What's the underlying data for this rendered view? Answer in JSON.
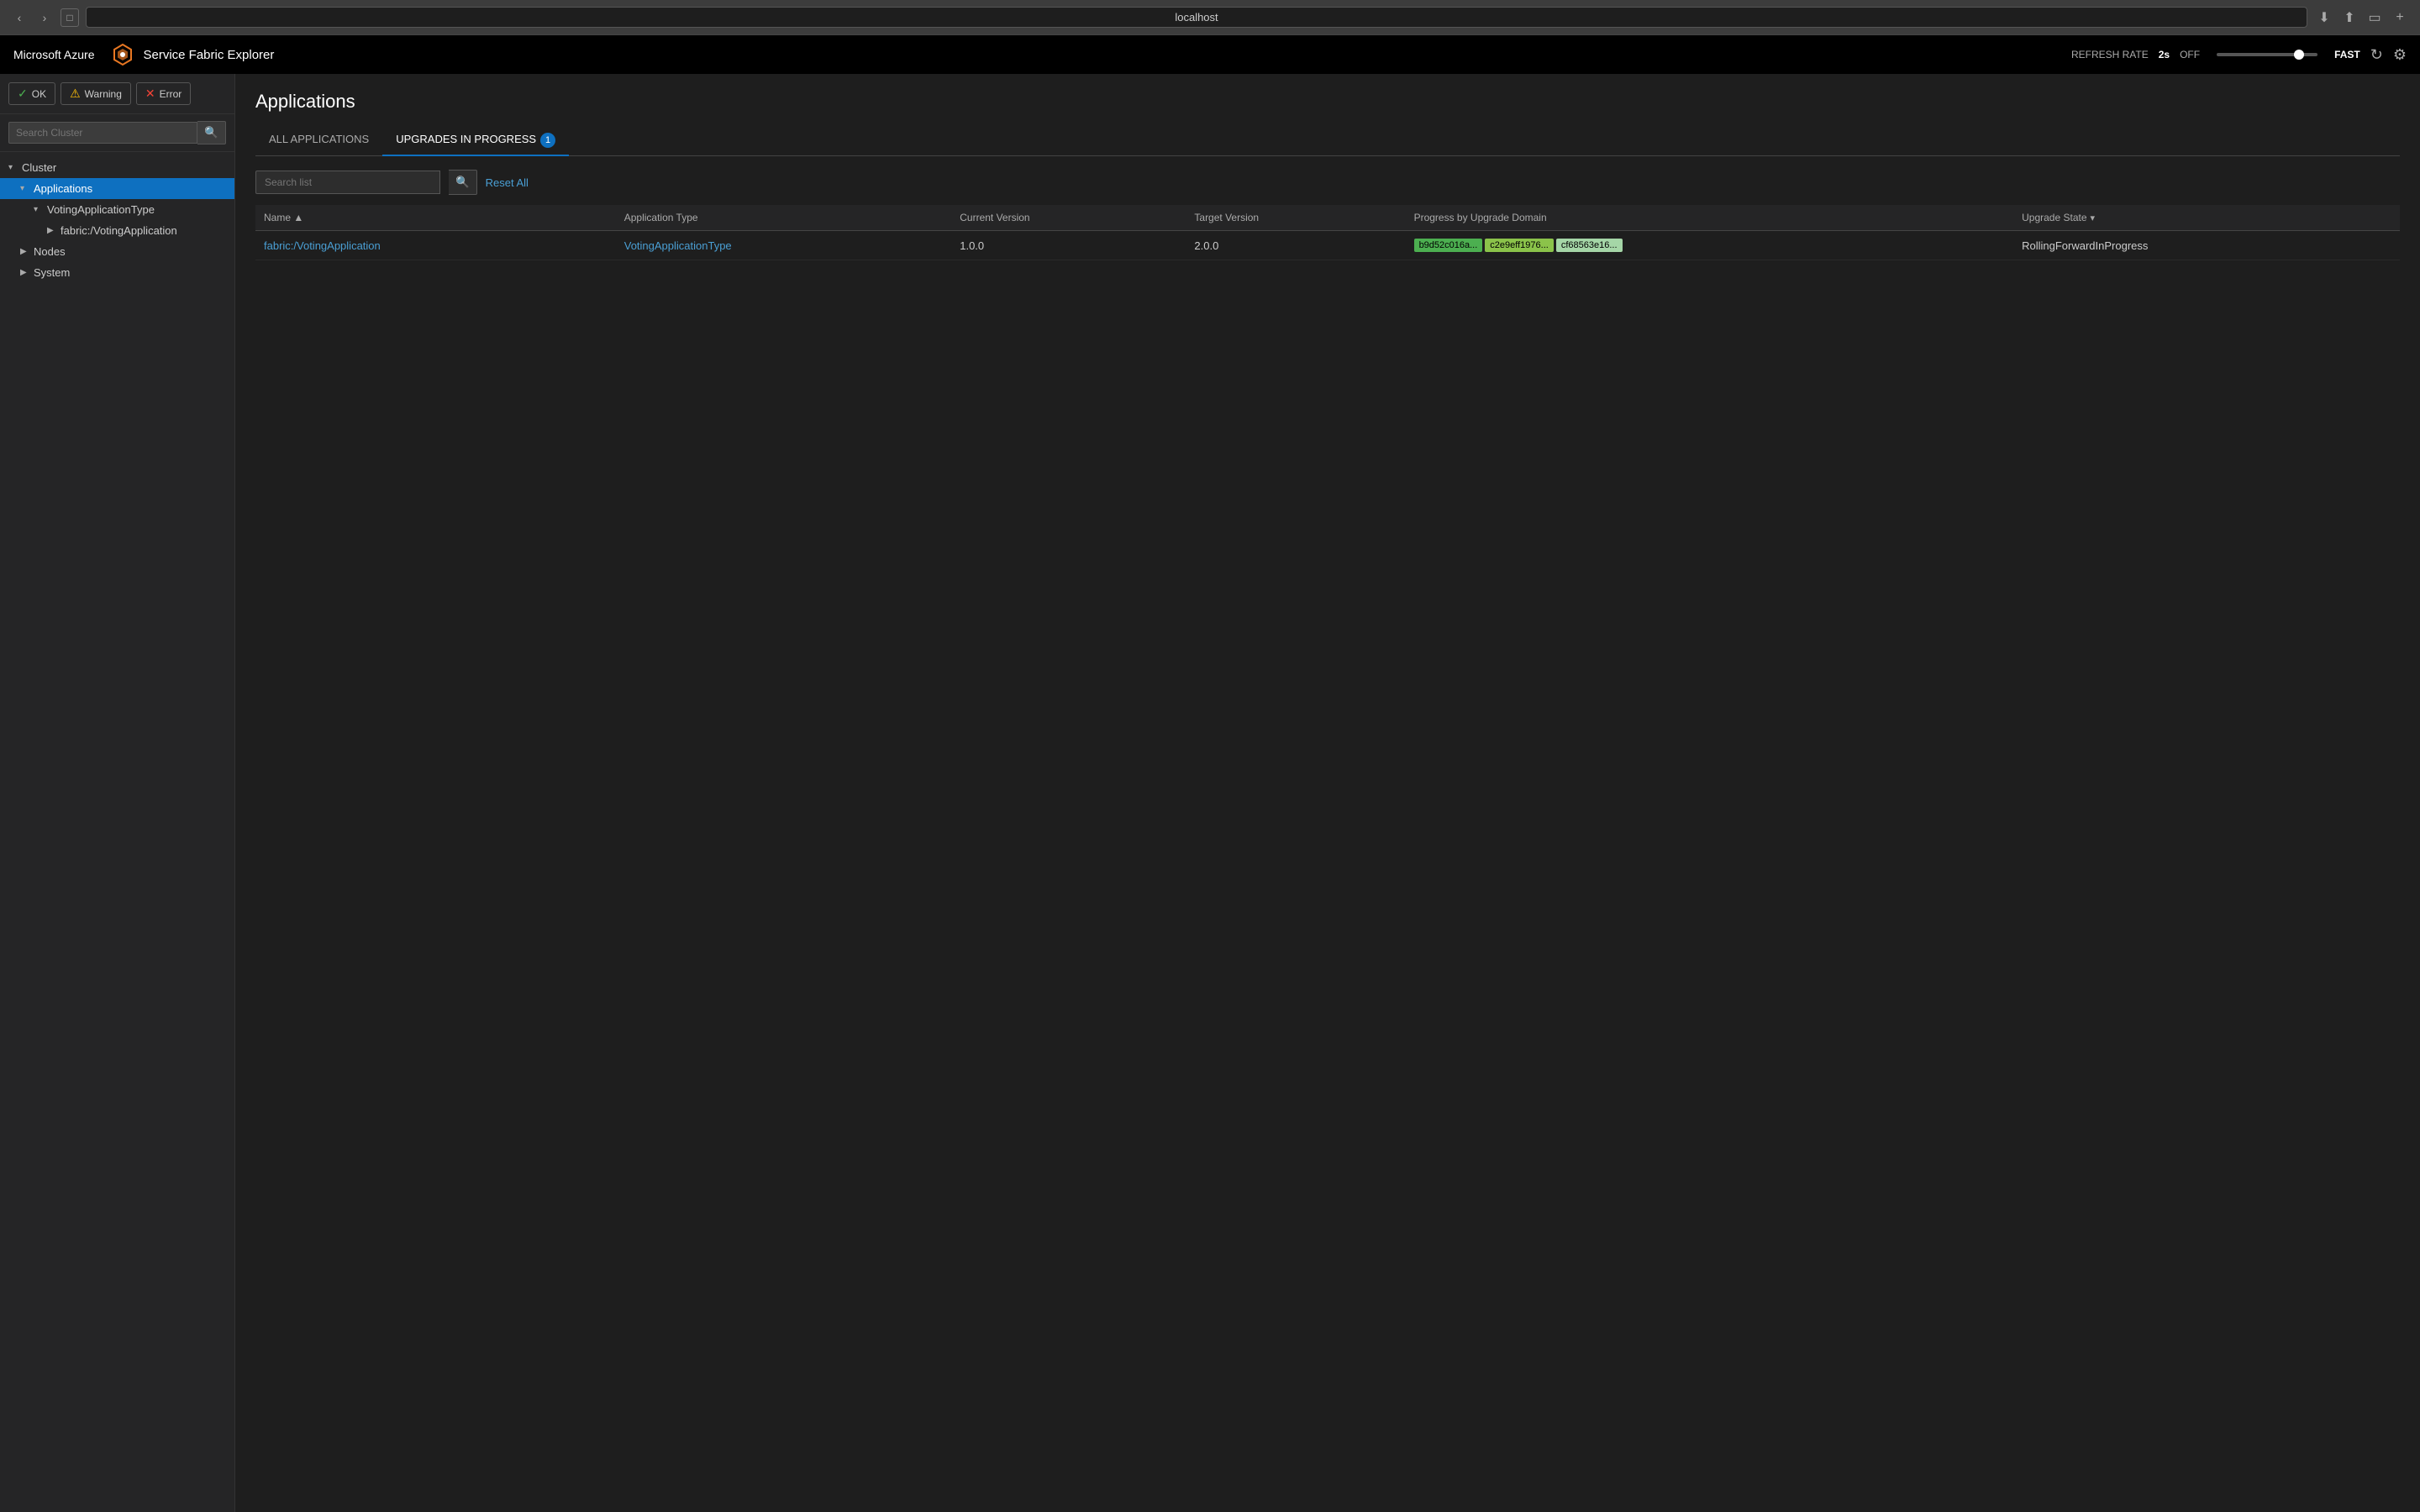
{
  "browser": {
    "url": "localhost",
    "nav_back": "‹",
    "nav_forward": "›",
    "nav_window": "□"
  },
  "topnav": {
    "azure_brand": "Microsoft Azure",
    "app_title": "Service Fabric Explorer",
    "refresh_rate_label": "REFRESH RATE",
    "refresh_value": "2s",
    "refresh_off": "OFF",
    "refresh_fast": "FAST",
    "settings_icon": "⚙",
    "refresh_icon": "↻"
  },
  "sidebar": {
    "search_placeholder": "Search Cluster",
    "status_ok": "OK",
    "status_warning": "Warning",
    "status_error": "Error",
    "tree": [
      {
        "level": 0,
        "label": "Cluster",
        "arrow": "▾",
        "selected": false
      },
      {
        "level": 1,
        "label": "Applications",
        "arrow": "▾",
        "selected": true
      },
      {
        "level": 2,
        "label": "VotingApplicationType",
        "arrow": "▾",
        "selected": false
      },
      {
        "level": 3,
        "label": "fabric:/VotingApplication",
        "arrow": "▶",
        "selected": false
      },
      {
        "level": 1,
        "label": "Nodes",
        "arrow": "▶",
        "selected": false
      },
      {
        "level": 1,
        "label": "System",
        "arrow": "▶",
        "selected": false
      }
    ]
  },
  "content": {
    "page_title": "Applications",
    "tabs": [
      {
        "label": "ALL APPLICATIONS",
        "active": false,
        "badge": null
      },
      {
        "label": "UPGRADES IN PROGRESS",
        "active": true,
        "badge": "1"
      }
    ],
    "search_placeholder": "Search list",
    "reset_all": "Reset All",
    "table": {
      "columns": [
        {
          "label": "Name ▲",
          "key": "name"
        },
        {
          "label": "Application Type",
          "key": "appType"
        },
        {
          "label": "Current Version",
          "key": "currentVersion"
        },
        {
          "label": "Target Version",
          "key": "targetVersion"
        },
        {
          "label": "Progress by Upgrade Domain",
          "key": "progress"
        },
        {
          "label": "Upgrade State",
          "key": "upgradeState",
          "filter": true
        }
      ],
      "rows": [
        {
          "name": "fabric:/VotingApplication",
          "appType": "VotingApplicationType",
          "currentVersion": "1.0.0",
          "targetVersion": "2.0.0",
          "upgradeDomains": [
            {
              "label": "b9d52c016a...",
              "status": "completed"
            },
            {
              "label": "c2e9eff1976...",
              "status": "in-progress"
            },
            {
              "label": "cf68563e16...",
              "status": "pending"
            }
          ],
          "upgradeState": "RollingForwardInProgress"
        }
      ]
    }
  }
}
